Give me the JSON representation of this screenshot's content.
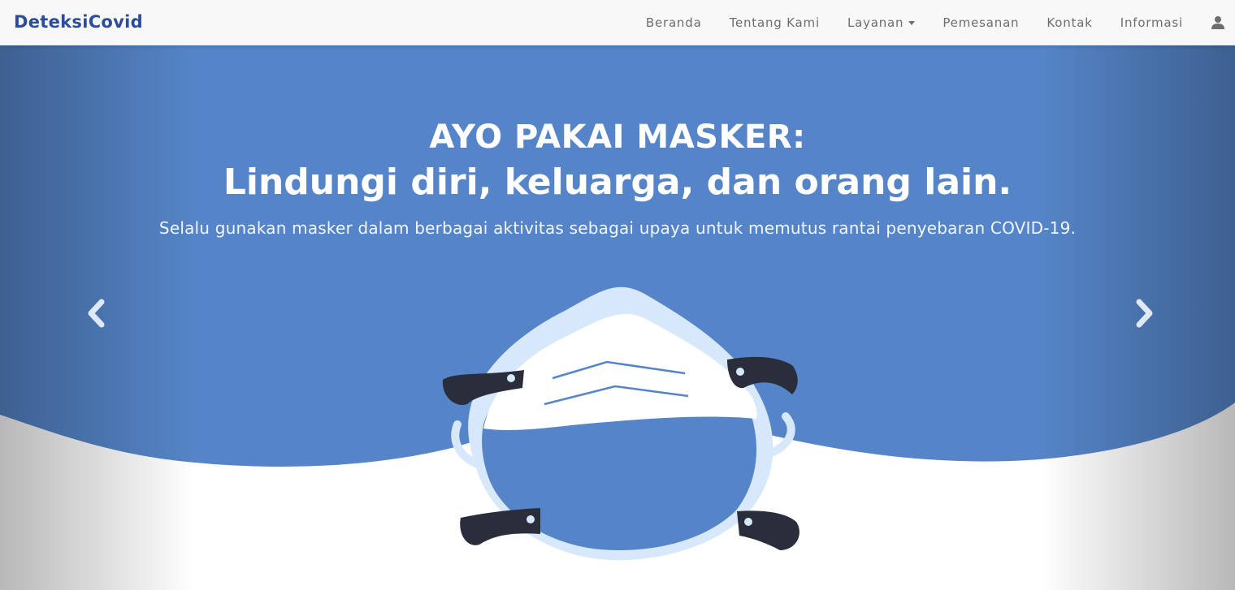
{
  "navbar": {
    "brand": "DeteksiCovid",
    "items": [
      {
        "label": "Beranda"
      },
      {
        "label": "Tentang Kami"
      },
      {
        "label": "Layanan",
        "dropdown": true
      },
      {
        "label": "Pemesanan"
      },
      {
        "label": "Kontak"
      },
      {
        "label": "Informasi"
      }
    ],
    "user_icon": "user-icon"
  },
  "carousel": {
    "title_line1": "AYO PAKAI MASKER:",
    "title_line2": "Lindungi diri, keluarga, dan orang lain.",
    "subtitle": "Selalu gunakan masker dalam berbagai aktivitas sebagai upaya untuk memutus rantai penyebaran COVID-19.",
    "prev_icon": "chevron-left-icon",
    "next_icon": "chevron-right-icon",
    "image": "face-mask-illustration"
  },
  "colors": {
    "brand": "#2b4c9a",
    "hero_blue": "#5585c8",
    "mask_blue": "#5585c8",
    "mask_outline": "#d6e8fa",
    "strap_dark": "#2a2d3a",
    "nav_bg": "#f8f8f8",
    "nav_text": "#6d6d6d"
  }
}
